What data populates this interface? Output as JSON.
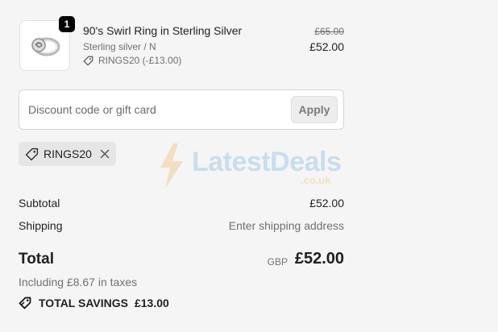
{
  "product": {
    "quantity": "1",
    "title": "90's Swirl Ring in Sterling Silver",
    "variant": "Sterling silver / N",
    "discount_applied": "RINGS20 (-£13.00)",
    "original_price": "£65.00",
    "price": "£52.00",
    "image_icon": "ring-image"
  },
  "discount": {
    "placeholder": "Discount code or gift card",
    "apply_label": "Apply"
  },
  "applied_code": {
    "label": "RINGS20",
    "tag_icon": "tag-icon",
    "remove_icon": "close-icon"
  },
  "watermark": {
    "brand": "LatestDeals",
    "domain": ".co.uk"
  },
  "summary": {
    "subtotal_label": "Subtotal",
    "subtotal_value": "£52.00",
    "shipping_label": "Shipping",
    "shipping_value": "Enter shipping address",
    "total_label": "Total",
    "currency": "GBP",
    "total_value": "£52.00",
    "taxes_note": "Including £8.67 in taxes",
    "savings_label": "TOTAL SAVINGS",
    "savings_value": "£13.00"
  },
  "colors": {
    "background": "#f5f5f5",
    "text": "#1f1f1f",
    "muted": "#707070",
    "badge": "#000000"
  }
}
